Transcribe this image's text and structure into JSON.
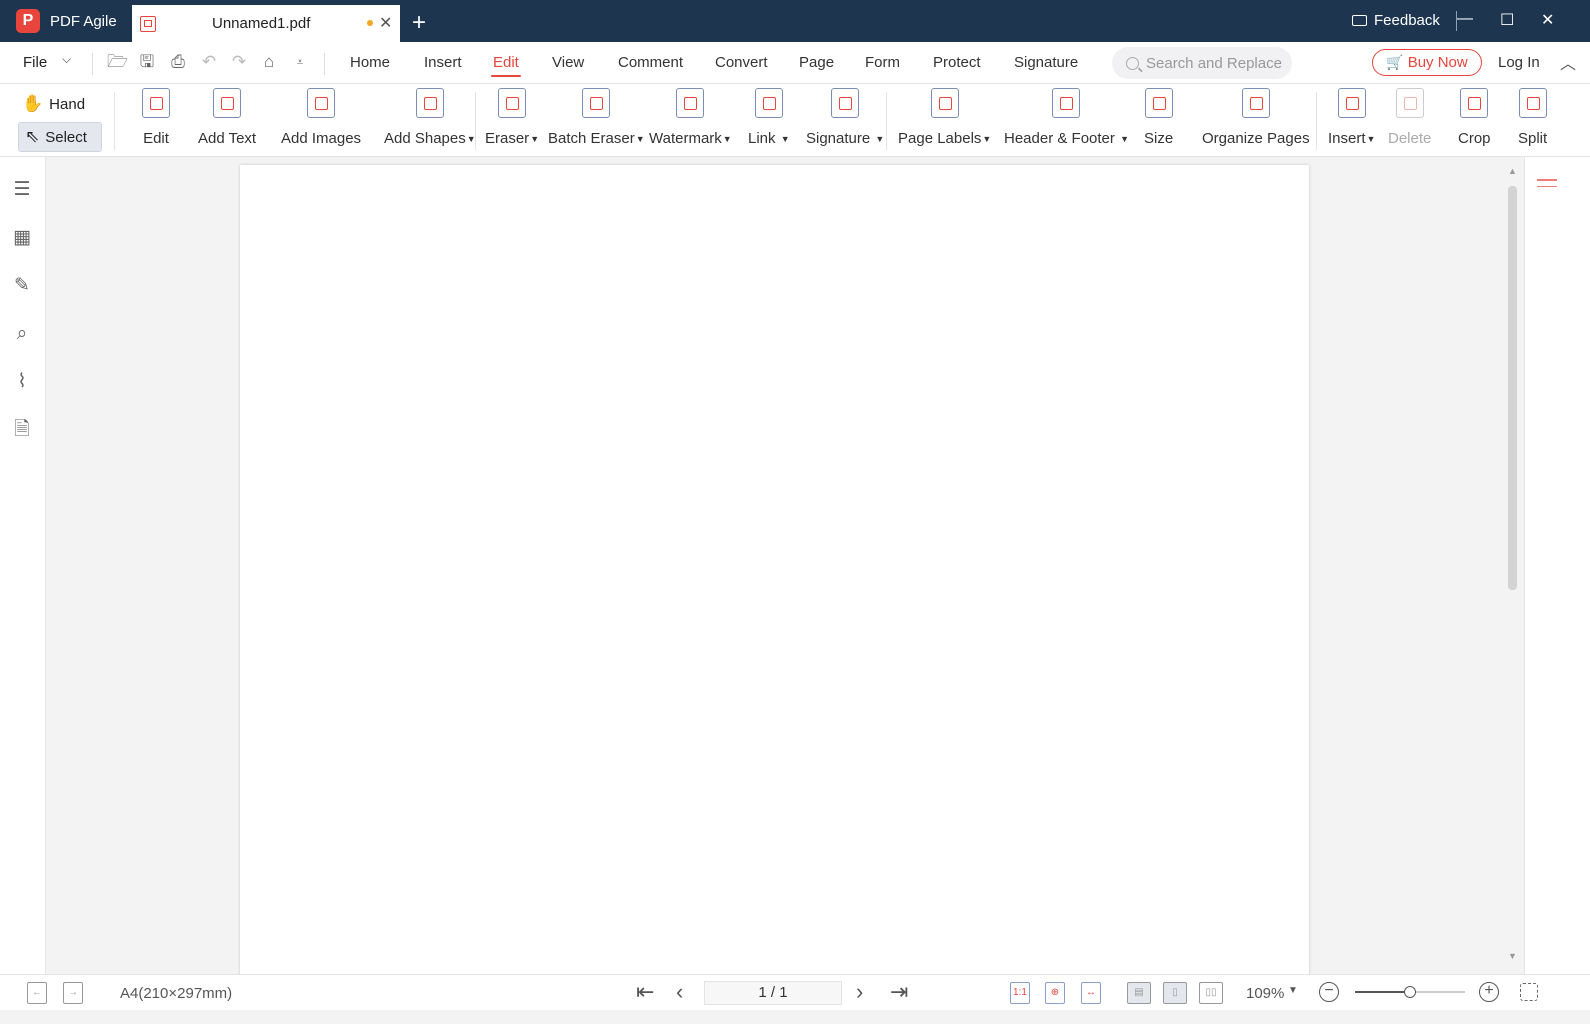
{
  "titlebar": {
    "app_name": "PDF Agile",
    "logo_letter": "P",
    "tab_name": "Unnamed1.pdf",
    "feedback": "Feedback",
    "minimize": "—",
    "maximize": "☐",
    "close": "✕"
  },
  "menubar": {
    "file": "File",
    "tabs": [
      "Home",
      "Insert",
      "Edit",
      "View",
      "Comment",
      "Convert",
      "Page",
      "Form",
      "Protect",
      "Signature"
    ],
    "active_tab": "Edit",
    "search_placeholder": "Search and Replace",
    "buy_now": "Buy Now",
    "login": "Log In"
  },
  "ribbon": {
    "hand": "Hand",
    "select": "Select",
    "buttons": [
      {
        "label": "Edit",
        "icon": "edit-icon"
      },
      {
        "label": "Add Text",
        "icon": "text-icon"
      },
      {
        "label": "Add Images",
        "icon": "image-icon"
      },
      {
        "label": "Add Shapes",
        "icon": "shapes-icon",
        "dropdown": true
      },
      {
        "label": "Eraser",
        "icon": "eraser-icon",
        "dropdown": true
      },
      {
        "label": "Batch Eraser",
        "icon": "batch-eraser-icon",
        "dropdown": true
      },
      {
        "label": "Watermark",
        "icon": "watermark-icon",
        "dropdown": true
      },
      {
        "label": "Link",
        "icon": "link-icon",
        "dropdown": true
      },
      {
        "label": "Signature",
        "icon": "signature-icon",
        "dropdown": true
      },
      {
        "label": "Page Labels",
        "icon": "page-labels-icon",
        "dropdown": true
      },
      {
        "label": "Header & Footer",
        "icon": "header-footer-icon",
        "dropdown": true
      },
      {
        "label": "Size",
        "icon": "size-icon"
      },
      {
        "label": "Organize Pages",
        "icon": "organize-pages-icon"
      },
      {
        "label": "Insert",
        "icon": "insert-page-icon",
        "dropdown": true
      },
      {
        "label": "Delete",
        "icon": "delete-page-icon",
        "disabled": true
      },
      {
        "label": "Crop",
        "icon": "crop-icon"
      },
      {
        "label": "Split",
        "icon": "split-icon"
      }
    ]
  },
  "statusbar": {
    "paper_size": "A4(210×297mm)",
    "page_indicator": "1 / 1",
    "zoom": "109%",
    "zoom_slider_fraction": 0.5
  },
  "colors": {
    "accent": "#e8453c",
    "titlebar": "#1e3550",
    "icon_outline": "#7b8fb3"
  }
}
